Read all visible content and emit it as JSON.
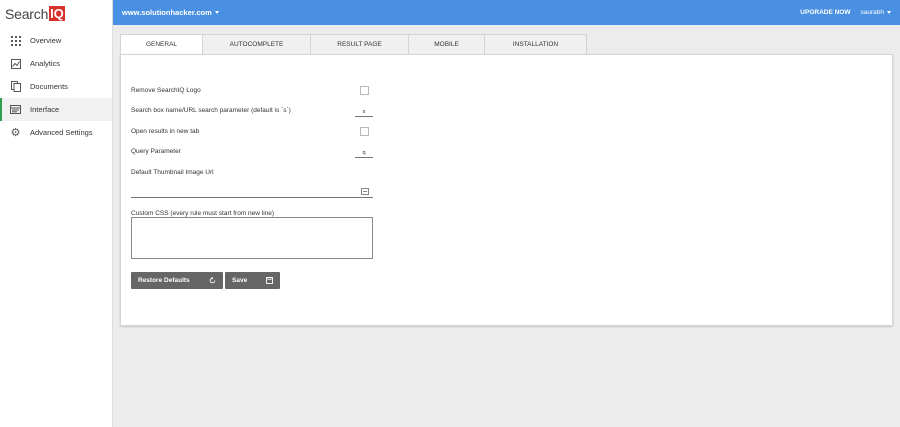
{
  "brand": {
    "name_prefix": "Search",
    "name_suffix": "IQ"
  },
  "sidebar": {
    "items": [
      {
        "label": "Overview",
        "icon": "grid-icon"
      },
      {
        "label": "Analytics",
        "icon": "chart-icon"
      },
      {
        "label": "Documents",
        "icon": "documents-icon"
      },
      {
        "label": "Interface",
        "icon": "interface-icon",
        "active": true
      },
      {
        "label": "Advanced Settings",
        "icon": "gear-icon"
      }
    ]
  },
  "topbar": {
    "site": "www.solutionhacker.com",
    "upgrade": "UPGRADE NOW",
    "user": "saurabh",
    "color": "#4a90e2"
  },
  "tabs": [
    {
      "label": "GENERAL",
      "active": true
    },
    {
      "label": "AUTOCOMPLETE"
    },
    {
      "label": "RESULT PAGE"
    },
    {
      "label": "MOBILE"
    },
    {
      "label": "INSTALLATION"
    }
  ],
  "form": {
    "remove_logo_label": "Remove SearchIQ Logo",
    "search_param_label": "Search box name/URL search parameter (default is `s`)",
    "search_param_value": "s",
    "new_tab_label": "Open results in new tab",
    "query_param_label": "Query Parameter",
    "query_param_value": "q",
    "thumbnail_label": "Default Thumbnail Image Url",
    "thumbnail_value": "",
    "css_label": "Custom CSS (every rule must start from new line)",
    "css_value": "",
    "restore_label": "Restore Defaults",
    "save_label": "Save"
  }
}
